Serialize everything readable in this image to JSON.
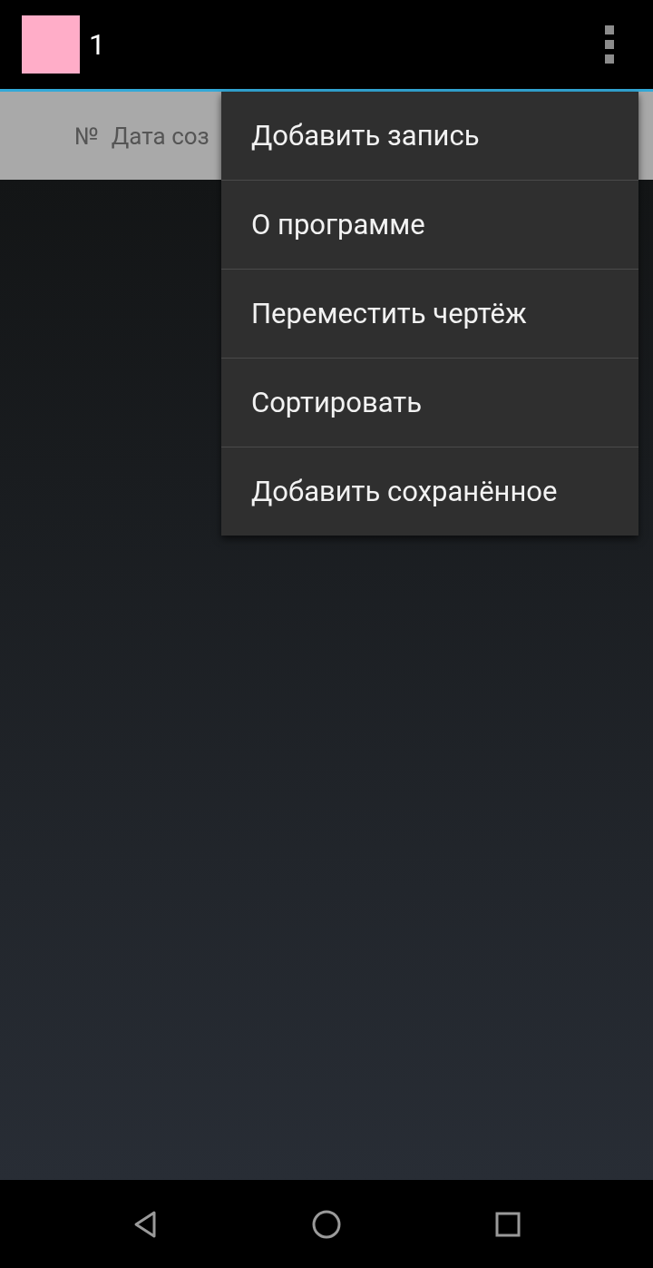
{
  "action_bar": {
    "title": "1"
  },
  "table_header": {
    "columns": [
      "№",
      "Дата соз"
    ]
  },
  "menu": {
    "items": [
      {
        "label": "Добавить запись"
      },
      {
        "label": "О программе"
      },
      {
        "label": "Переместить чертёж"
      },
      {
        "label": "Сортировать"
      },
      {
        "label": "Добавить сохранённое"
      }
    ]
  }
}
